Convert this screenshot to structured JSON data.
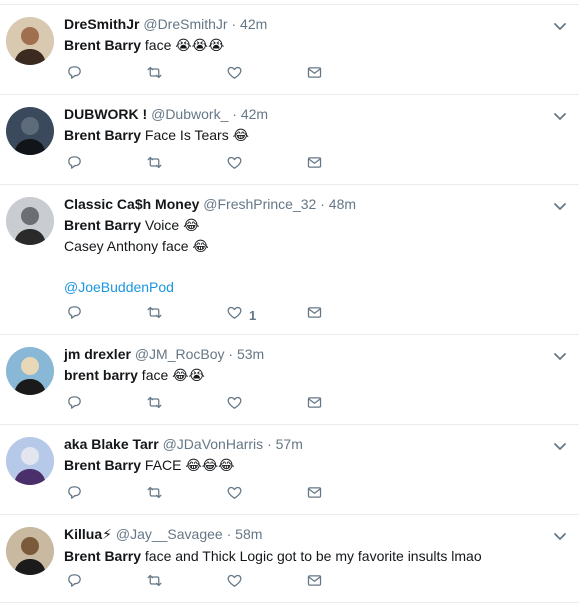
{
  "tweets": [
    {
      "name": "DreSmithJr",
      "handle": "@DreSmithJr",
      "time": "42m",
      "lines": [
        {
          "bold": "Brent Barry",
          "text": " face ",
          "emoji": "😭😭😭"
        }
      ],
      "likes": ""
    },
    {
      "name": "DUBWORK !",
      "handle": "@Dubwork_",
      "time": "42m",
      "lines": [
        {
          "bold": "Brent Barry",
          "text": " Face Is Tears ",
          "emoji": "😂"
        }
      ],
      "likes": ""
    },
    {
      "name": "Classic Ca$h Money",
      "handle": "@FreshPrince_32",
      "time": "48m",
      "lines": [
        {
          "bold": "Brent Barry",
          "text": " Voice ",
          "emoji": "😂"
        },
        {
          "bold": "",
          "text": "Casey Anthony face ",
          "emoji": "😂"
        },
        {
          "bold": "",
          "text": "",
          "emoji": ""
        },
        {
          "mention": "@JoeBuddenPod"
        }
      ],
      "likes": "1"
    },
    {
      "name": "jm drexler",
      "handle": "@JM_RocBoy",
      "time": "53m",
      "lines": [
        {
          "bold": "brent barry",
          "text": " face ",
          "emoji": "😂😭"
        }
      ],
      "likes": ""
    },
    {
      "name": "aka Blake Tarr",
      "handle": "@JDaVonHarris",
      "time": "57m",
      "lines": [
        {
          "bold": "Brent Barry",
          "text": " FACE ",
          "emoji": "😂😂😂"
        }
      ],
      "likes": ""
    },
    {
      "name": "Killua",
      "name_emoji": "⚡",
      "handle": "@Jay__Savagee",
      "time": "58m",
      "lines": [
        {
          "bold": "Brent Barry",
          "text": " face and Thick Logic got to be my favorite insults lmao",
          "emoji": ""
        }
      ],
      "likes": ""
    }
  ],
  "separator": "·",
  "colors": {
    "text": "#14171a",
    "secondary": "#657786",
    "link": "#1b95e0",
    "divider": "#e6ecf0"
  },
  "icons": {
    "reply": "reply-icon",
    "retweet": "retweet-icon",
    "like": "heart-icon",
    "dm": "envelope-icon",
    "caret": "chevron-down-icon"
  }
}
